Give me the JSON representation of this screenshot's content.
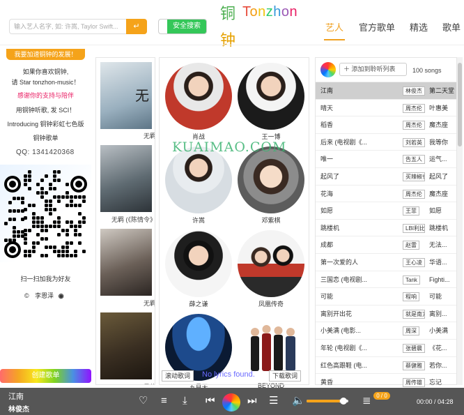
{
  "header": {
    "search_placeholder": "输入艺人名字, 如: 许嵩, Taylor Swift...",
    "search_icon": "enter-arrow-icon",
    "safe_search_label": "安全搜索",
    "logo_cn_1": "铜",
    "logo_cn_2": "钟",
    "logo_en": "Tonzhon",
    "nav": [
      "艺人",
      "官方歌单",
      "精选",
      "歌单"
    ]
  },
  "sidebar": {
    "promo": "我要加速铜钟的发展！",
    "lines": [
      "如果你喜欢铜钟,",
      "请 Star tonzhon-music！",
      "感谢你的支持与陪伴",
      "用铜钟听歌, 发 SCI！",
      "Introducing 铜钟彩虹七色版",
      "铜钟歌单"
    ],
    "qq": "QQ:  1341420368",
    "qr_caption": "扫一扫加我为好友",
    "author": "李恩泽",
    "create_list": "创建歌单"
  },
  "thumbs": [
    {
      "caption": "无羁"
    },
    {
      "caption": "无羁 (《陈情令》"
    },
    {
      "caption": "无羁"
    },
    {
      "caption": "最佳"
    }
  ],
  "artists": [
    {
      "name": "肖战"
    },
    {
      "name": "王一博"
    },
    {
      "name": "许嵩"
    },
    {
      "name": "邓紫棋"
    },
    {
      "name": "薛之谦"
    },
    {
      "name": "凤凰传奇"
    },
    {
      "name": "五月天"
    },
    {
      "name": "BEYOND"
    }
  ],
  "watermark": "KUAIMAO.COM",
  "songlist": {
    "add_label": "添加到聆听列表",
    "count": "100 songs",
    "songs": [
      {
        "name": "江南",
        "artist": "林俊杰",
        "album": "第二天堂"
      },
      {
        "name": "晴天",
        "artist": "周杰伦",
        "album": "叶惠美"
      },
      {
        "name": "稻香",
        "artist": "周杰伦",
        "album": "魔杰座"
      },
      {
        "name": "后来 (电视剧《...",
        "artist": "刘若英",
        "album": "我等你"
      },
      {
        "name": "唯一",
        "artist": "告五人",
        "album": "运气..."
      },
      {
        "name": "起风了",
        "artist": "买辣椒也用券",
        "album": "起风了"
      },
      {
        "name": "花海",
        "artist": "周杰伦",
        "album": "魔杰座"
      },
      {
        "name": "如愿",
        "artist": "王菲",
        "album": "如愿"
      },
      {
        "name": "跳楼机",
        "artist": "LBI利比",
        "album": "跳楼机"
      },
      {
        "name": "成都",
        "artist": "赵雷",
        "album": "无法..."
      },
      {
        "name": "第一次爱的人",
        "artist": "王心凌",
        "album": "华语..."
      },
      {
        "name": "三国恋 (电视剧...",
        "artist": "Tank",
        "album": "Fighti..."
      },
      {
        "name": "可能",
        "artist": "程响",
        "album": "可能"
      },
      {
        "name": "离别开出花",
        "artist": "就是南方凯",
        "album": "离别..."
      },
      {
        "name": "小美满 (电影...",
        "artist": "周深",
        "album": "小美满"
      },
      {
        "name": "年轮 (电视剧《...",
        "artist": "张碧晨",
        "album": "《花..."
      },
      {
        "name": "红色高跟鞋 (电...",
        "artist": "蔡健雅",
        "album": "若你..."
      },
      {
        "name": "黄昏",
        "artist": "周传雄",
        "album": "忘记"
      }
    ]
  },
  "lyrics": {
    "scroll_label": "滚动歌词",
    "status": "No lyrics found.",
    "download_label": "下载歌词"
  },
  "player": {
    "title": "江南",
    "artist": "林俊杰",
    "time": "00:00 / 04:28",
    "lyric_count": "0 / 0",
    "volume": 0.8
  }
}
